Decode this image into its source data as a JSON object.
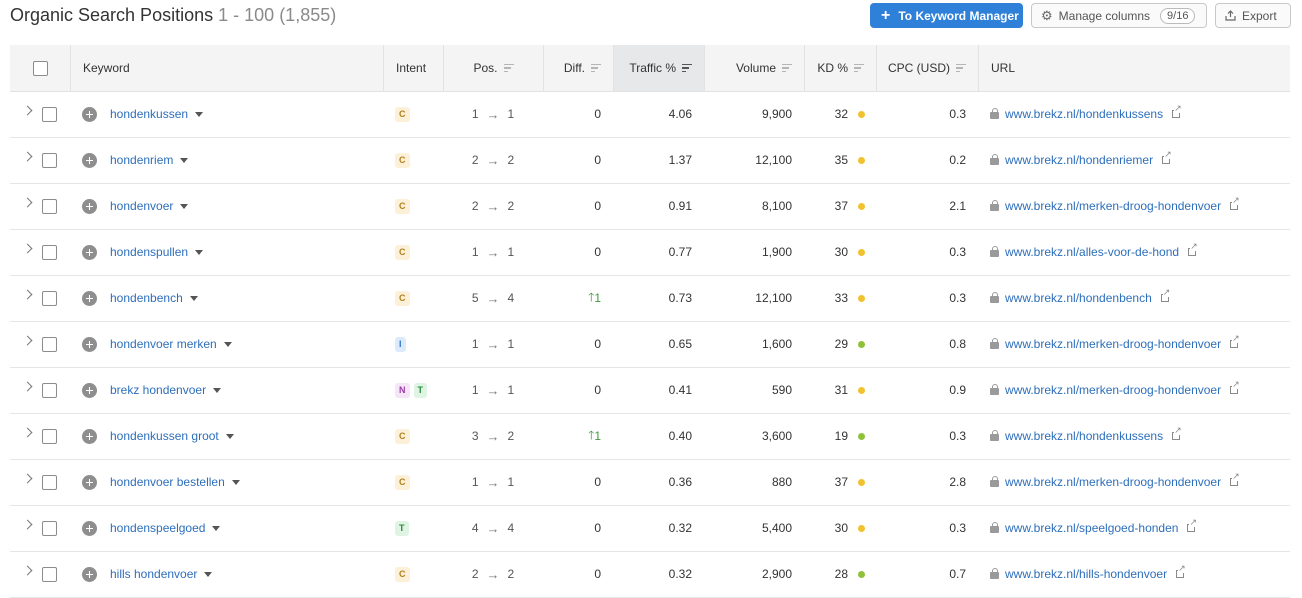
{
  "header": {
    "title": "Organic Search Positions",
    "range": "1 - 100",
    "total": "(1,855)",
    "to_keyword_manager": "To Keyword Manager",
    "manage_columns": "Manage columns",
    "columns_count": "9/16",
    "export": "Export"
  },
  "columns": {
    "keyword": "Keyword",
    "intent": "Intent",
    "pos": "Pos.",
    "diff": "Diff.",
    "traffic": "Traffic %",
    "volume": "Volume",
    "kd": "KD %",
    "cpc": "CPC (USD)",
    "url": "URL"
  },
  "colors": {
    "accent": "#2f80d8",
    "link": "#2d6fbb",
    "kd_yellow": "#f2c12e",
    "kd_green": "#8fc23a",
    "diff_up": "#3c9b3c"
  },
  "rows": [
    {
      "keyword": "hondenkussen",
      "intent": [
        "C"
      ],
      "pos_from": "1",
      "pos_to": "1",
      "diff": "0",
      "diff_up": false,
      "traffic": "4.06",
      "volume": "9,900",
      "kd": "32",
      "kd_color": "yellow",
      "cpc": "0.3",
      "url": "www.brekz.nl/hondenkussens"
    },
    {
      "keyword": "hondenriem",
      "intent": [
        "C"
      ],
      "pos_from": "2",
      "pos_to": "2",
      "diff": "0",
      "diff_up": false,
      "traffic": "1.37",
      "volume": "12,100",
      "kd": "35",
      "kd_color": "yellow",
      "cpc": "0.2",
      "url": "www.brekz.nl/hondenriemer"
    },
    {
      "keyword": "hondenvoer",
      "intent": [
        "C"
      ],
      "pos_from": "2",
      "pos_to": "2",
      "diff": "0",
      "diff_up": false,
      "traffic": "0.91",
      "volume": "8,100",
      "kd": "37",
      "kd_color": "yellow",
      "cpc": "2.1",
      "url": "www.brekz.nl/merken-droog-hondenvoer"
    },
    {
      "keyword": "hondenspullen",
      "intent": [
        "C"
      ],
      "pos_from": "1",
      "pos_to": "1",
      "diff": "0",
      "diff_up": false,
      "traffic": "0.77",
      "volume": "1,900",
      "kd": "30",
      "kd_color": "yellow",
      "cpc": "0.3",
      "url": "www.brekz.nl/alles-voor-de-hond"
    },
    {
      "keyword": "hondenbench",
      "intent": [
        "C"
      ],
      "pos_from": "5",
      "pos_to": "4",
      "diff": "1",
      "diff_up": true,
      "traffic": "0.73",
      "volume": "12,100",
      "kd": "33",
      "kd_color": "yellow",
      "cpc": "0.3",
      "url": "www.brekz.nl/hondenbench"
    },
    {
      "keyword": "hondenvoer merken",
      "intent": [
        "I"
      ],
      "pos_from": "1",
      "pos_to": "1",
      "diff": "0",
      "diff_up": false,
      "traffic": "0.65",
      "volume": "1,600",
      "kd": "29",
      "kd_color": "green",
      "cpc": "0.8",
      "url": "www.brekz.nl/merken-droog-hondenvoer"
    },
    {
      "keyword": "brekz hondenvoer",
      "intent": [
        "N",
        "T"
      ],
      "pos_from": "1",
      "pos_to": "1",
      "diff": "0",
      "diff_up": false,
      "traffic": "0.41",
      "volume": "590",
      "kd": "31",
      "kd_color": "yellow",
      "cpc": "0.9",
      "url": "www.brekz.nl/merken-droog-hondenvoer"
    },
    {
      "keyword": "hondenkussen groot",
      "intent": [
        "C"
      ],
      "pos_from": "3",
      "pos_to": "2",
      "diff": "1",
      "diff_up": true,
      "traffic": "0.40",
      "volume": "3,600",
      "kd": "19",
      "kd_color": "green",
      "cpc": "0.3",
      "url": "www.brekz.nl/hondenkussens"
    },
    {
      "keyword": "hondenvoer bestellen",
      "intent": [
        "C"
      ],
      "pos_from": "1",
      "pos_to": "1",
      "diff": "0",
      "diff_up": false,
      "traffic": "0.36",
      "volume": "880",
      "kd": "37",
      "kd_color": "yellow",
      "cpc": "2.8",
      "url": "www.brekz.nl/merken-droog-hondenvoer"
    },
    {
      "keyword": "hondenspeelgoed",
      "intent": [
        "T"
      ],
      "pos_from": "4",
      "pos_to": "4",
      "diff": "0",
      "diff_up": false,
      "traffic": "0.32",
      "volume": "5,400",
      "kd": "30",
      "kd_color": "yellow",
      "cpc": "0.3",
      "url": "www.brekz.nl/speelgoed-honden"
    },
    {
      "keyword": "hills hondenvoer",
      "intent": [
        "C"
      ],
      "pos_from": "2",
      "pos_to": "2",
      "diff": "0",
      "diff_up": false,
      "traffic": "0.32",
      "volume": "2,900",
      "kd": "28",
      "kd_color": "green",
      "cpc": "0.7",
      "url": "www.brekz.nl/hills-hondenvoer"
    }
  ]
}
